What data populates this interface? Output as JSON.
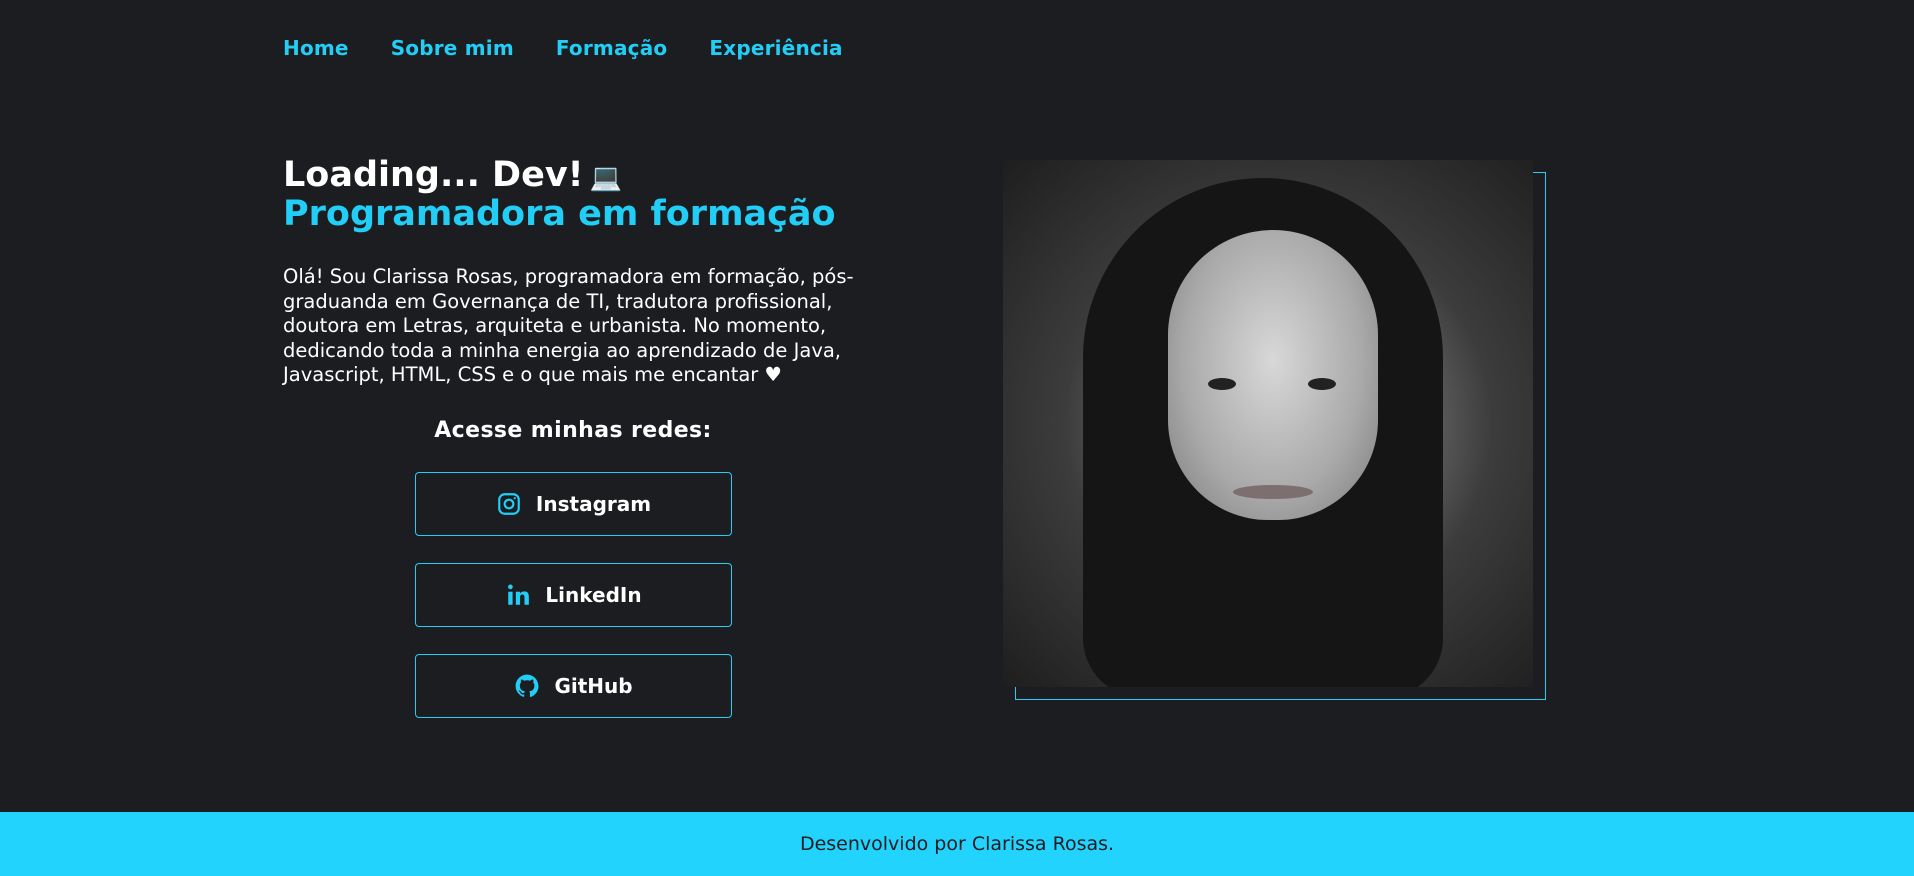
{
  "nav": {
    "items": [
      {
        "label": "Home"
      },
      {
        "label": "Sobre mim"
      },
      {
        "label": "Formação"
      },
      {
        "label": "Experiência"
      }
    ]
  },
  "hero": {
    "title": "Loading... Dev!",
    "title_emoji": "💻",
    "subtitle": "Programadora em formação",
    "bio": "Olá! Sou Clarissa Rosas, programadora em formação, pós-graduanda em Governança de TI, tradutora profissional, doutora em Letras, arquiteta e urbanista. No momento, dedicando toda a minha energia ao aprendizado de Java, Javascript, HTML, CSS e o que mais me encantar ♥"
  },
  "social": {
    "heading": "Acesse minhas redes:",
    "buttons": [
      {
        "label": "Instagram",
        "icon": "instagram-icon"
      },
      {
        "label": "LinkedIn",
        "icon": "linkedin-icon"
      },
      {
        "label": "GitHub",
        "icon": "github-icon"
      }
    ]
  },
  "footer": {
    "text": "Desenvolvido por Clarissa Rosas."
  },
  "colors": {
    "background": "#1c1d21",
    "accent": "#22cef5",
    "footer_bg": "#22d3fd",
    "text": "#ffffff"
  }
}
